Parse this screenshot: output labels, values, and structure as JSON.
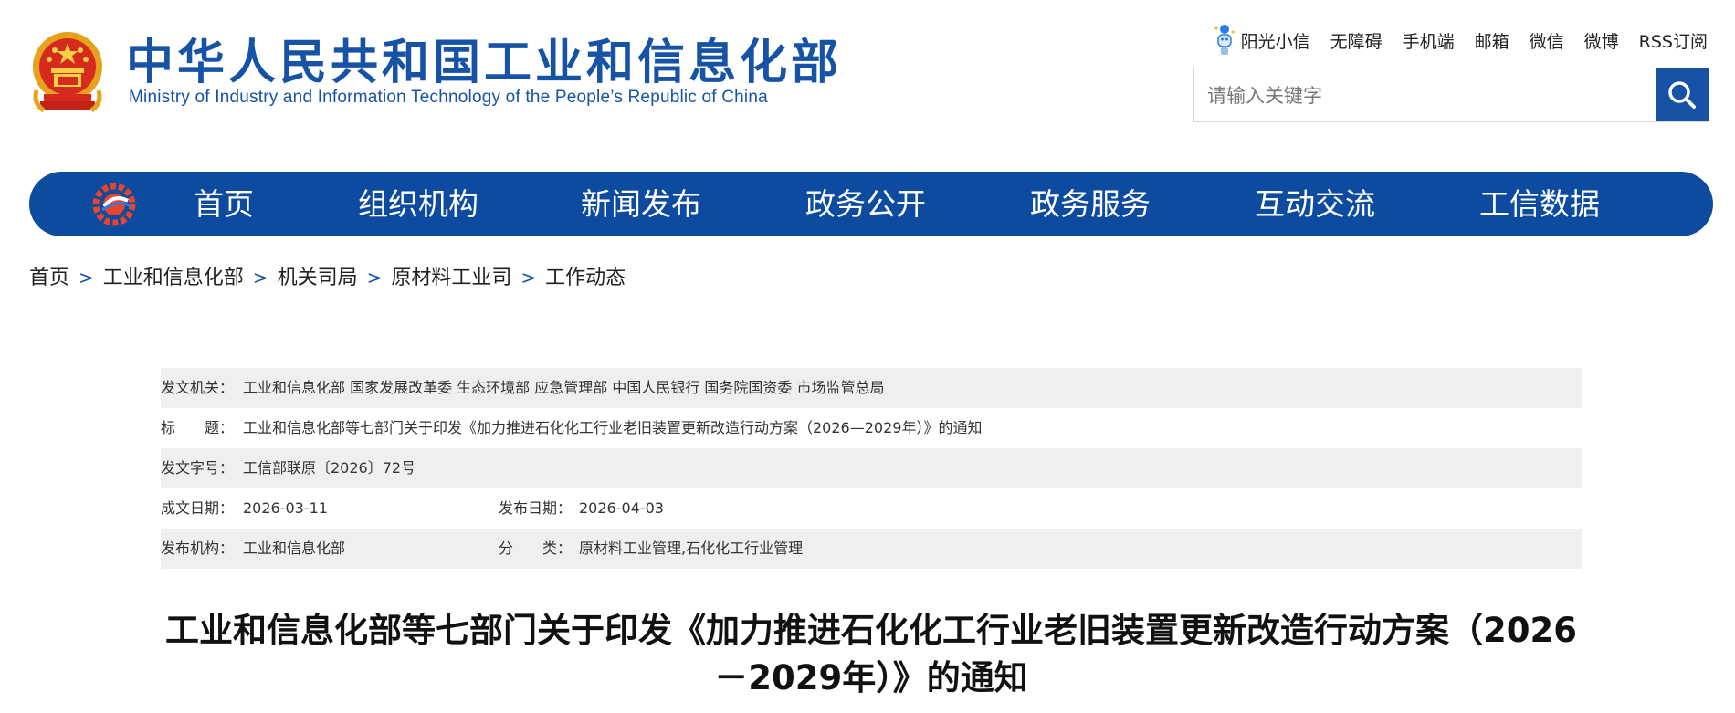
{
  "header": {
    "cn_title": "中华人民共和国工业和信息化部",
    "en_title": "Ministry of Industry and Information Technology of the People’s Republic of China",
    "links": [
      "阳光小信",
      "无障碍",
      "手机端",
      "邮箱",
      "微信",
      "微博",
      "RSS订阅"
    ],
    "search_placeholder": "请输入关键字",
    "brand_color": "#1653a6"
  },
  "nav": {
    "items": [
      "首页",
      "组织机构",
      "新闻发布",
      "政务公开",
      "政务服务",
      "互动交流",
      "工信数据"
    ],
    "bg_color": "#0c4b9f"
  },
  "breadcrumb": [
    "首页",
    "工业和信息化部",
    "机关司局",
    "原材料工业司",
    "工作动态"
  ],
  "breadcrumb_sep": ">",
  "info": {
    "issuer_label": "发文机关：",
    "issuer_value": "工业和信息化部 国家发展改革委 生态环境部 应急管理部 中国人民银行 国务院国资委 市场监管总局",
    "title_label": "标　　题：",
    "title_value": "工业和信息化部等七部门关于印发《加力推进石化化工行业老旧装置更新改造行动方案（2026—2029年）》的通知",
    "docno_label": "发文字号：",
    "docno_value": "工信部联原〔2026〕72号",
    "written_label": "成文日期：",
    "written_value": "2026-03-11",
    "published_label": "发布日期：",
    "published_value": "2026-04-03",
    "org_label": "发布机构：",
    "org_value": "工业和信息化部",
    "category_label": "分　　类：",
    "category_value": "原材料工业管理,石化化工行业管理"
  },
  "article": {
    "title": "工业和信息化部等七部门关于印发《加力推进石化化工行业老旧装置更新改造行动方案（2026－2029年）》的通知"
  }
}
